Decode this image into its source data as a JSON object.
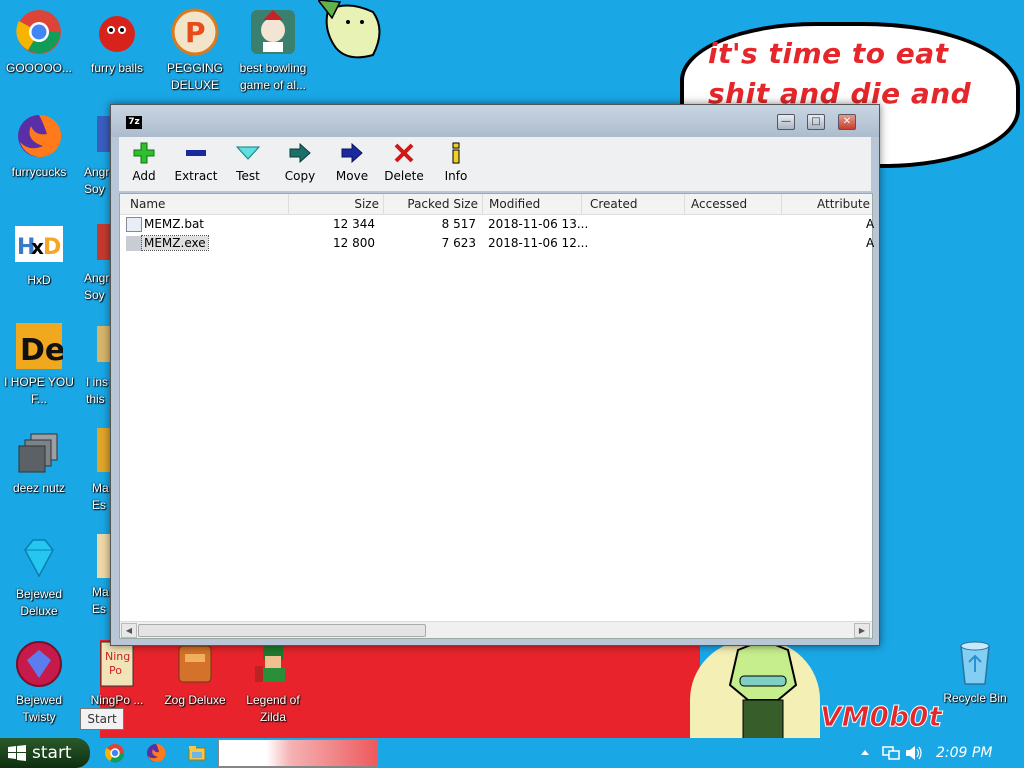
{
  "wallpaper": {
    "bubble_text": "it's time to eat shit and die and chew",
    "signature": "VM0b0t"
  },
  "desktop_icons": [
    {
      "label": "GOOOOO...",
      "icon": "chrome-icon"
    },
    {
      "label": "furry balls",
      "icon": "red-ball-icon"
    },
    {
      "label": "PEGGING DELUXE",
      "icon": "peggle-icon"
    },
    {
      "label": "best bowling game of al...",
      "icon": "bowling-icon"
    },
    {
      "label": "furrycucks",
      "icon": "firefox-icon"
    },
    {
      "label": "HxD",
      "icon": "hxd-icon"
    },
    {
      "label": "I HOPE YOU F...",
      "icon": "de-icon"
    },
    {
      "label": "deez nutz",
      "icon": "files-icon"
    },
    {
      "label": "Bejewed Deluxe",
      "icon": "diamond-icon"
    },
    {
      "label": "Bejewed Twisty",
      "icon": "gem-icon"
    },
    {
      "label": "NingPo ...",
      "icon": "ningpo-icon"
    },
    {
      "label": "Zog Deluxe",
      "icon": "zog-icon"
    },
    {
      "label": "Legend of Zilda",
      "icon": "zelda-icon"
    },
    {
      "label": "Recycle Bin",
      "icon": "recycle-bin-icon"
    }
  ],
  "partial_labels": {
    "angry1": "Angr Soy",
    "angry2": "Angr Soy",
    "i_ins": "I ins this",
    "ma1": "Ma Es",
    "ma2": "Ma Es"
  },
  "window": {
    "app_icon_text": "7z",
    "toolbar": [
      {
        "label": "Add",
        "icon": "plus-icon"
      },
      {
        "label": "Extract",
        "icon": "minus-icon"
      },
      {
        "label": "Test",
        "icon": "check-icon"
      },
      {
        "label": "Copy",
        "icon": "copy-arrow-icon"
      },
      {
        "label": "Move",
        "icon": "move-arrow-icon"
      },
      {
        "label": "Delete",
        "icon": "delete-x-icon"
      },
      {
        "label": "Info",
        "icon": "info-icon"
      }
    ],
    "columns": [
      "Name",
      "Size",
      "Packed Size",
      "Modified",
      "Created",
      "Accessed",
      "Attribute"
    ],
    "rows": [
      {
        "name": "MEMZ.bat",
        "size": "12 344",
        "packed": "8 517",
        "modified": "2018-11-06 13...",
        "attr": "A"
      },
      {
        "name": "MEMZ.exe",
        "size": "12 800",
        "packed": "7 623",
        "modified": "2018-11-06 12...",
        "attr": "A"
      }
    ]
  },
  "tooltip": "Start",
  "taskbar": {
    "start_label": "start",
    "clock": "2:09 PM"
  },
  "colors": {
    "desktop": "#1aa7e6",
    "red_text": "#e5262a"
  }
}
